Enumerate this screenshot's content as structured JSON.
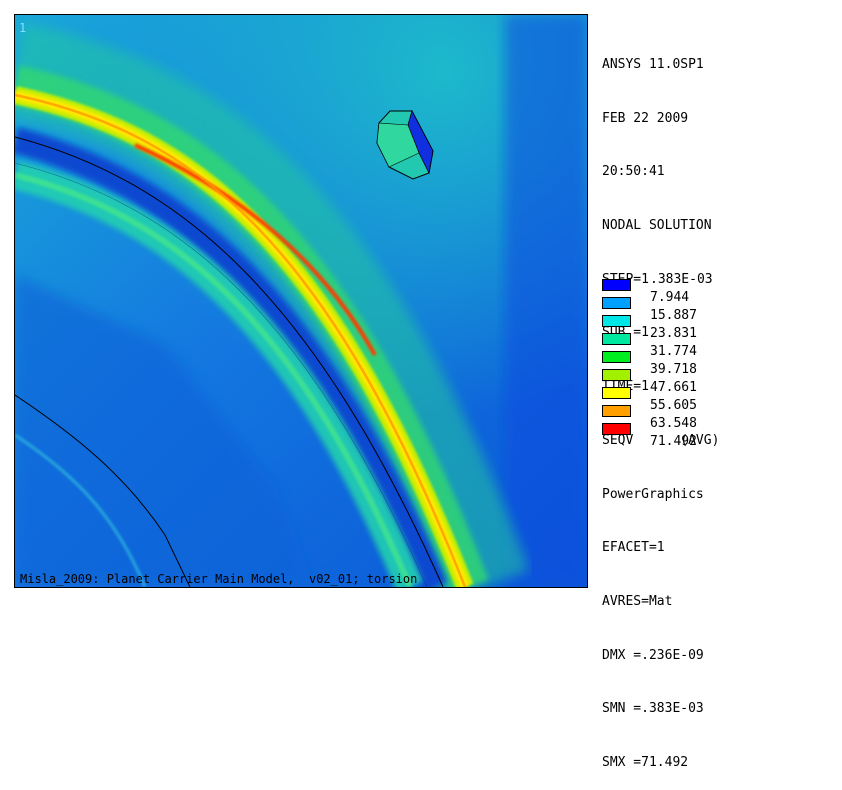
{
  "viewport": {
    "window_number": "1",
    "footer": "Misla_2009: Planet Carrier Main Model,  v02_01; torsion"
  },
  "info": {
    "lines": [
      "ANSYS 11.0SP1",
      "FEB 22 2009",
      "20:50:41",
      "NODAL SOLUTION",
      "STEP=1",
      "SUB =1",
      "TIME=1",
      "SEQV      (AVG)",
      "PowerGraphics",
      "EFACET=1",
      "AVRES=Mat",
      "DMX =.236E-09",
      "SMN =.383E-03",
      "SMX =71.492"
    ]
  },
  "legend": {
    "values": [
      ".383E-03",
      "7.944",
      "15.887",
      "23.831",
      "31.774",
      "39.718",
      "47.661",
      "55.605",
      "63.548",
      "71.492"
    ],
    "colors": [
      "#0000ff",
      "#00a0ff",
      "#00e6e6",
      "#00e8a0",
      "#00ee20",
      "#a0f000",
      "#ffff00",
      "#ffa000",
      "#ff0000"
    ]
  }
}
